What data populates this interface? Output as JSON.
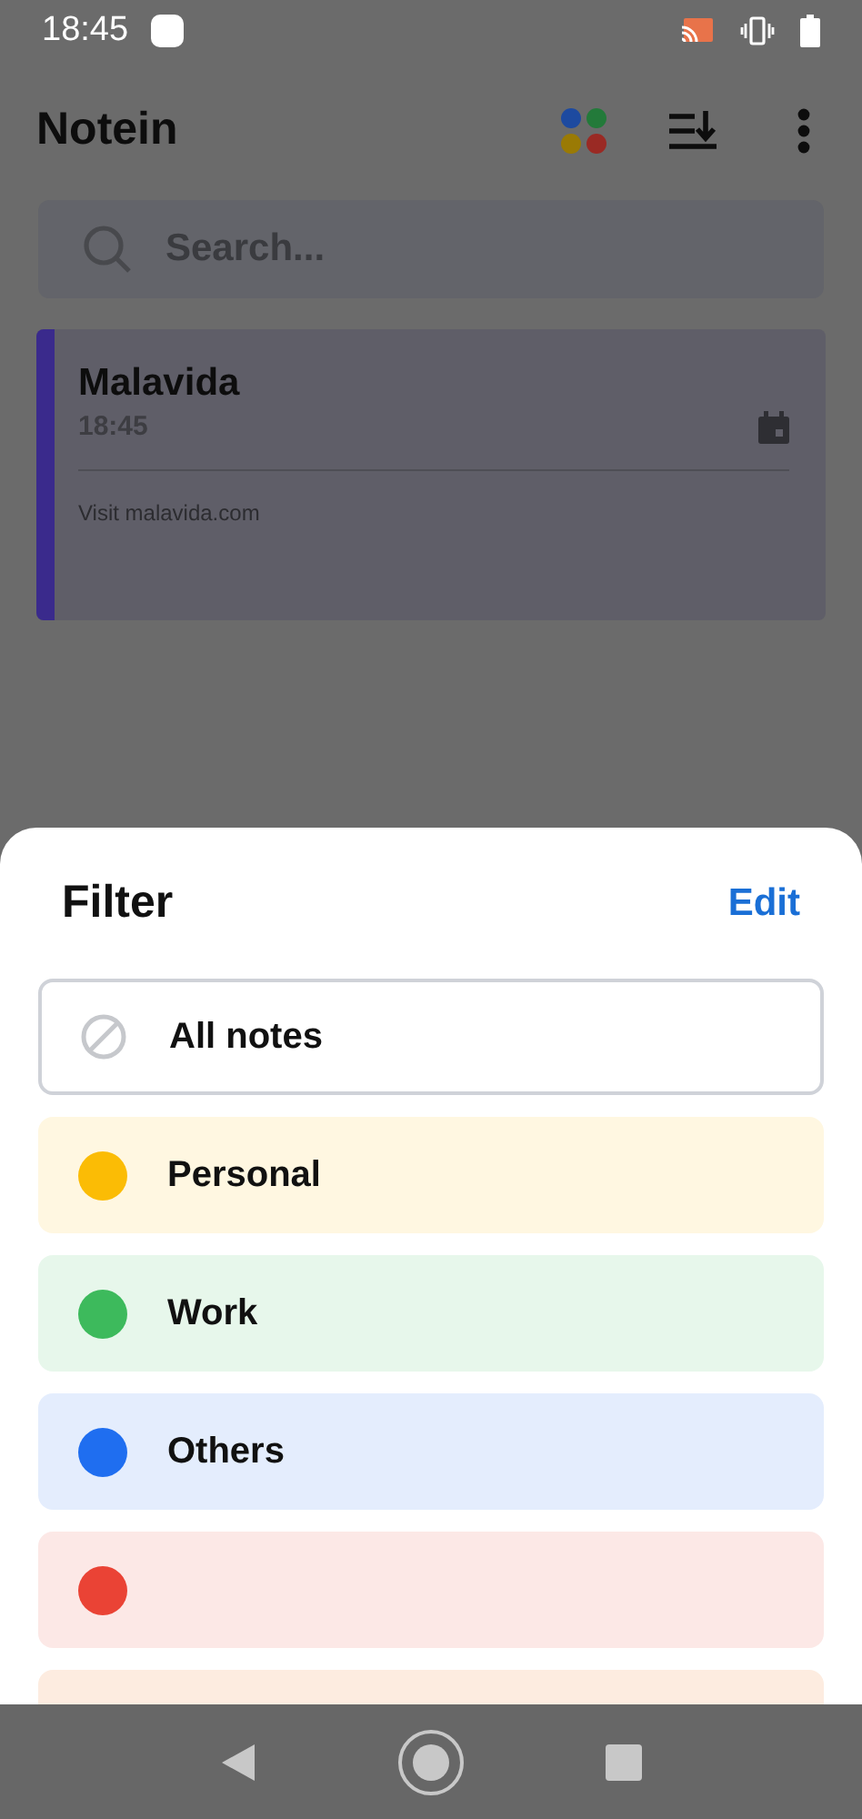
{
  "status_bar": {
    "time": "18:45"
  },
  "app_bar": {
    "title": "Notein"
  },
  "search": {
    "placeholder": "Search..."
  },
  "notes": [
    {
      "title": "Malavida",
      "time": "18:45",
      "body": "Visit malavida.com",
      "color": "#3a2a8c"
    }
  ],
  "filter_sheet": {
    "title": "Filter",
    "edit": "Edit",
    "items": [
      {
        "kind": "all",
        "label": "All notes",
        "selected": true
      },
      {
        "kind": "color",
        "label": "Personal",
        "color": "#fbbc05",
        "selected": false
      },
      {
        "kind": "color",
        "label": "Work",
        "color": "#3dba5c",
        "selected": false
      },
      {
        "kind": "color",
        "label": "Others",
        "color": "#1f6ef0",
        "selected": false
      },
      {
        "kind": "color",
        "color": "#ea4335",
        "selected": false
      },
      {
        "kind": "cut",
        "color": "#fdece0",
        "selected": false
      }
    ]
  }
}
